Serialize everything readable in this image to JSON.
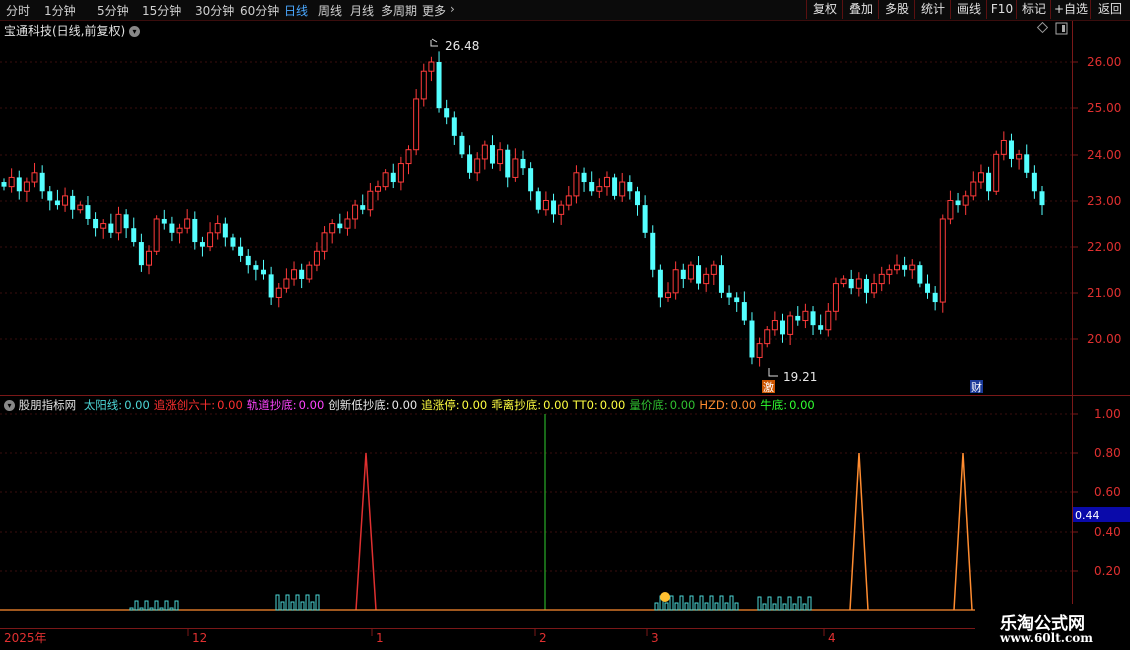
{
  "toolbar": {
    "periods": [
      "分时",
      "1分钟",
      "5分钟",
      "15分钟",
      "30分钟",
      "60分钟",
      "日线",
      "周线",
      "月线",
      "多周期",
      "更多"
    ],
    "active_period": "日线",
    "more_arrow": "›",
    "right_buttons": [
      "复权",
      "叠加",
      "多股",
      "统计",
      "画线",
      "F10",
      "标记",
      "+自选",
      "返回"
    ]
  },
  "chart": {
    "title": "宝通科技(日线,前复权)",
    "high_label": "26.48",
    "low_label": "19.21",
    "marker_ji": "激",
    "marker_cai": "财",
    "price_ticks": [
      "26.00",
      "25.00",
      "24.00",
      "23.00",
      "22.00",
      "21.00",
      "20.00"
    ],
    "up_color": "#ff3b3b",
    "down_color": "#54ffff"
  },
  "indicator": {
    "name": "股朋指标网",
    "items": [
      {
        "label": "太阳线:",
        "value": "0.00",
        "color": "#4dd6d6"
      },
      {
        "label": "追涨创六十:",
        "value": "0.00",
        "color": "#ff3030"
      },
      {
        "label": "轨道抄底:",
        "value": "0.00",
        "color": "#ff44ff"
      },
      {
        "label": "创新低抄底:",
        "value": "0.00",
        "color": "#e8e8e8"
      },
      {
        "label": "追涨停:",
        "value": "0.00",
        "color": "#ffff40"
      },
      {
        "label": "乖离抄底:",
        "value": "0.00",
        "color": "#ffff40"
      },
      {
        "label": "TT0:",
        "value": "0.00",
        "color": "#ffff40"
      },
      {
        "label": "量价底:",
        "value": "0.00",
        "color": "#30c030"
      },
      {
        "label": "HZD:",
        "value": "0.00",
        "color": "#ff8c30"
      },
      {
        "label": "牛底:",
        "value": "0.00",
        "color": "#30ff30"
      }
    ],
    "ticks": [
      "1.00",
      "0.80",
      "0.60",
      "0.40",
      "0.20"
    ],
    "current_value": "0.44"
  },
  "date_axis": [
    "2025年",
    "12",
    "1",
    "2",
    "3",
    "4"
  ],
  "watermark": {
    "line1": "乐淘公式网",
    "line2": "www.60lt.com"
  }
}
